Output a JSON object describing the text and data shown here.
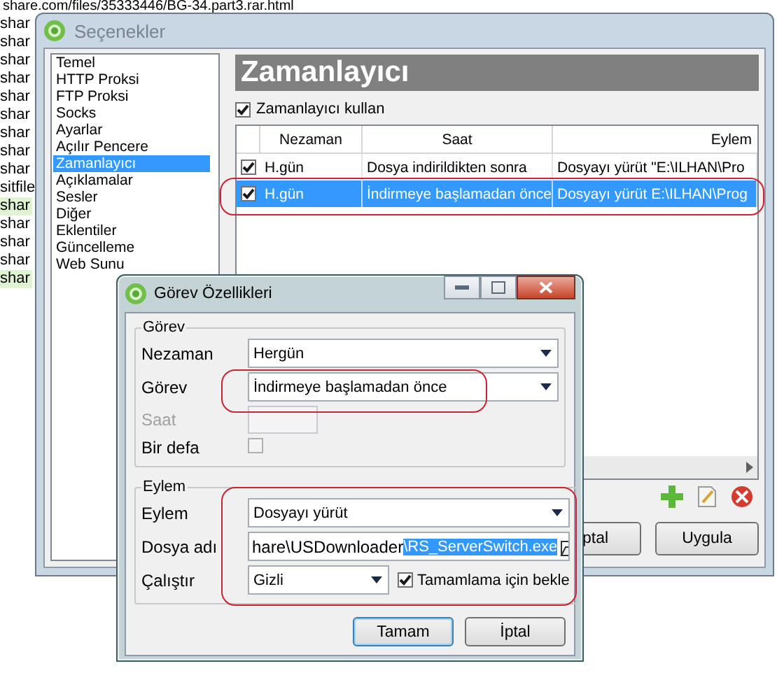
{
  "background_page": {
    "url_line": "share.com/files/35333446/BG-34.part3.rar.html",
    "lines": [
      {
        "text": "shar",
        "highlighted": false
      },
      {
        "text": "shar",
        "highlighted": false
      },
      {
        "text": "shar",
        "highlighted": false
      },
      {
        "text": "shar",
        "highlighted": false
      },
      {
        "text": "shar",
        "highlighted": false
      },
      {
        "text": "shar",
        "highlighted": false
      },
      {
        "text": "shar",
        "highlighted": false
      },
      {
        "text": "shar",
        "highlighted": false
      },
      {
        "text": "shar",
        "highlighted": false
      },
      {
        "text": "sitfile",
        "highlighted": false
      },
      {
        "text": "shar",
        "highlighted": true
      },
      {
        "text": "shar",
        "highlighted": false
      },
      {
        "text": "shar",
        "highlighted": false
      },
      {
        "text": "shar",
        "highlighted": false
      },
      {
        "text": "shar",
        "highlighted": true
      }
    ]
  },
  "options_window": {
    "title": "Seçenekler",
    "sidebar": {
      "items": [
        {
          "label": "Temel",
          "selected": false
        },
        {
          "label": "HTTP Proksi",
          "selected": false
        },
        {
          "label": "FTP Proksi",
          "selected": false
        },
        {
          "label": "Socks",
          "selected": false
        },
        {
          "label": "Ayarlar",
          "selected": false
        },
        {
          "label": "Açılır Pencere",
          "selected": false
        },
        {
          "label": "Zamanlayıcı",
          "selected": true
        },
        {
          "label": "Açıklamalar",
          "selected": false
        },
        {
          "label": "Sesler",
          "selected": false
        },
        {
          "label": "Diğer",
          "selected": false
        },
        {
          "label": "Eklentiler",
          "selected": false
        },
        {
          "label": "Güncelleme",
          "selected": false
        },
        {
          "label": "Web Sunu",
          "selected": false
        }
      ]
    },
    "panel_title": "Zamanlayıcı",
    "use_timer": {
      "label": "Zamanlayıcı kullan",
      "checked": true
    },
    "table": {
      "columns": [
        "Nezaman",
        "Saat",
        "Eylem"
      ],
      "rows": [
        {
          "checked": true,
          "selected": false,
          "cells": [
            "H.gün",
            "Dosya indirildikten sonra",
            "Dosyayı yürüt \"E:\\ILHAN\\Pro"
          ]
        },
        {
          "checked": true,
          "selected": true,
          "cells": [
            "H.gün",
            "İndirmeye başlamadan önce",
            "Dosyayı yürüt E:\\ILHAN\\Prog"
          ]
        }
      ]
    },
    "buttons": [
      "ptal",
      "Uygula"
    ]
  },
  "task_dialog": {
    "title": "Görev Özellikleri",
    "task_group": {
      "legend": "Görev",
      "when": {
        "label": "Nezaman",
        "value": "Hergün"
      },
      "task": {
        "label": "Görev",
        "value": "İndirmeye başlamadan önce"
      },
      "time": {
        "label": "Saat",
        "disabled": true
      },
      "once": {
        "label": "Bir defa",
        "checked": false
      }
    },
    "action_group": {
      "legend": "Eylem",
      "action": {
        "label": "Eylem",
        "value": "Dosyayı yürüt"
      },
      "file": {
        "label": "Dosya adı",
        "value": "hare\\USDownloader",
        "selected_text": "\\RS_ServerSwitch.exe"
      },
      "run": {
        "label": "Çalıştır",
        "value": "Gizli"
      },
      "wait": {
        "label": "Tamamlama için bekle",
        "checked": true
      }
    },
    "buttons": [
      "Tamam",
      "İptal"
    ]
  }
}
